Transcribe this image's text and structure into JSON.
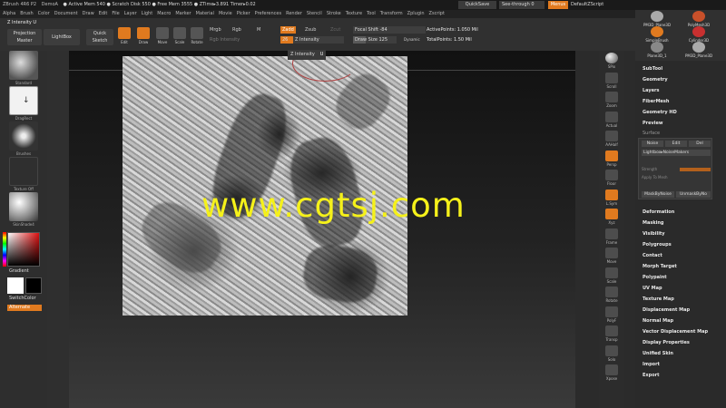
{
  "titlebar": {
    "app": "ZBrush 4R6 P2",
    "doc": "DemoA",
    "stats": "● Active Mem 540 ● Scratch Disk 550 ● Free Mem 3555 ● ZTime▸3.891 Timer▸0.02",
    "quicksave": "QuickSave",
    "seethrough": "See-through  0",
    "menus": "Menus",
    "defaultscript": "DefaultZScript"
  },
  "menubar": [
    "Alpha",
    "Brush",
    "Color",
    "Document",
    "Draw",
    "Edit",
    "File",
    "Layer",
    "Light",
    "Macro",
    "Marker",
    "Material",
    "Movie",
    "Picker",
    "Preferences",
    "Render",
    "Stencil",
    "Stroke",
    "Texture",
    "Tool",
    "Transform",
    "Zplugin",
    "Zscript"
  ],
  "toolbar": {
    "zintensity_tag": "Z Intensity   U",
    "projection": "Projection\nMaster",
    "lightbox": "LightBox",
    "quicksketch": "Quick\nSketch",
    "edit": "Edit",
    "draw": "Draw",
    "move": "Move",
    "scale": "Scale",
    "rotate": "Rotate",
    "mrgb": "Mrgb",
    "rgb": "Rgb",
    "m": "M",
    "rgb_intensity": "Rgb Intensity",
    "zadd": "Zadd",
    "zsub": "Zsub",
    "zcut": "Zcut",
    "z_intensity_val": "26",
    "z_intensity_lbl": "Z Intensity",
    "focal_shift": "Focal Shift -84",
    "draw_size": "Draw Size 125",
    "dynamic": "Dynamic",
    "active_points": "ActivePoints: 1.050 Mil",
    "total_points": "TotalPoints: 1.50 Mil"
  },
  "hud": {
    "label": "Z Intensity",
    "value": "U"
  },
  "leftshelf": {
    "brush1": "Standard",
    "brush2": "DragRect",
    "brush3": "Brushes",
    "brush4": "Texture Off",
    "brush5": "SkinShade4",
    "gradient": "Gradient",
    "switchcolor": "SwitchColor",
    "alternate": "Alternate"
  },
  "watermark": "www.cgtsj.com",
  "rightshelf": [
    "SPix",
    "Scroll",
    "Zoom",
    "Actual",
    "AAHalf",
    "Persp",
    "Floor",
    "L.Sym",
    "Xyz",
    "Frame",
    "Move",
    "Scale",
    "Rotate",
    "PolyF",
    "Transp",
    "Solo",
    "Xpose"
  ],
  "tools": [
    {
      "name": "PM3D_Plane3D",
      "color": "#aaaaaa"
    },
    {
      "name": "PolyMesh3D",
      "color": "#c8502a"
    },
    {
      "name": "SimpleBrush",
      "color": "#e07a1f"
    },
    {
      "name": "Cylinder3D",
      "color": "#c83030"
    },
    {
      "name": "Plane3D_1",
      "color": "#888888"
    },
    {
      "name": "PM3D_Plane3D",
      "color": "#aaaaaa"
    }
  ],
  "palette": {
    "items_top": [
      "SubTool",
      "Geometry",
      "Layers",
      "FiberMesh",
      "Geometry HD",
      "Preview"
    ],
    "surface": "Surface",
    "noise": "Noise",
    "edit": "Edit",
    "del": "Del",
    "lightbox_noise": "Lightbox▸NoiseMakers",
    "strength": "Strength",
    "apply": "Apply To Mesh",
    "maskbynoise": "MaskByNoise",
    "unmaskbynoise": "UnmaskByNo",
    "items_bottom": [
      "Deformation",
      "Masking",
      "Visibility",
      "Polygroups",
      "Contact",
      "Morph Target",
      "Polypaint",
      "UV Map",
      "Texture Map",
      "Displacement Map",
      "Normal Map",
      "Vector Displacement Map",
      "Display Properties",
      "Unified Skin",
      "Import",
      "Export"
    ]
  }
}
